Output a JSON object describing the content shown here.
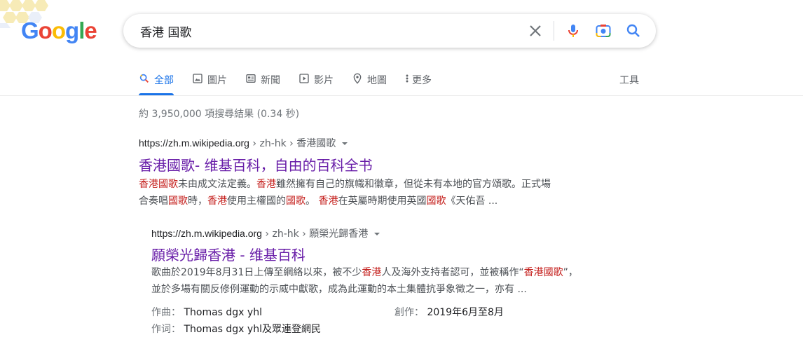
{
  "logo": {
    "letters": [
      {
        "ch": "G",
        "color": "#4285f4"
      },
      {
        "ch": "o",
        "color": "#ea4335"
      },
      {
        "ch": "o",
        "color": "#fbbc05"
      },
      {
        "ch": "g",
        "color": "#4285f4"
      },
      {
        "ch": "l",
        "color": "#34a853"
      },
      {
        "ch": "e",
        "color": "#ea4335"
      }
    ]
  },
  "search": {
    "query": "香港 国歌"
  },
  "tabs": [
    {
      "label": "全部",
      "icon": "search-icon",
      "active": true
    },
    {
      "label": "圖片",
      "icon": "image-icon",
      "active": false
    },
    {
      "label": "新聞",
      "icon": "news-icon",
      "active": false
    },
    {
      "label": "影片",
      "icon": "video-icon",
      "active": false
    },
    {
      "label": "地圖",
      "icon": "map-pin-icon",
      "active": false
    },
    {
      "label": "更多",
      "icon": "more-vert-icon",
      "active": false
    }
  ],
  "tools_label": "工具",
  "stats": "約 3,950,000 項搜尋結果 (0.34 秒)",
  "results": [
    {
      "domain": "https://zh.m.wikipedia.org",
      "path": " › zh-hk › 香港國歌",
      "title": "香港國歌- 维基百科，自由的百科全书",
      "snippet": [
        [
          [
            "香港國歌",
            true
          ],
          [
            "未由成文法定義。",
            false
          ],
          [
            "香港",
            true
          ],
          [
            "雖然擁有自己的旗幟和徽章，但從未有本地的官方頌歌。正式場",
            false
          ]
        ],
        [
          [
            "合奏唱",
            false
          ],
          [
            "國歌",
            true
          ],
          [
            "時，",
            false
          ],
          [
            "香港",
            true
          ],
          [
            "使用主權國的",
            false
          ],
          [
            "國歌",
            true
          ],
          [
            "。 ",
            false
          ],
          [
            "香港",
            true
          ],
          [
            "在英屬時期使用英國",
            false
          ],
          [
            "國歌",
            true
          ],
          [
            "《天佑吾 ...",
            false
          ]
        ]
      ]
    },
    {
      "domain": "https://zh.m.wikipedia.org",
      "path": " › zh-hk › 願榮光歸香港",
      "title": "願榮光歸香港 - 维基百科",
      "snippet": [
        [
          [
            "歌曲於2019年8月31日上傳至網絡以來，被不少",
            false
          ],
          [
            "香港",
            true
          ],
          [
            "人及海外支持者認可，並被稱作“",
            false
          ],
          [
            "香港國歌",
            true
          ],
          [
            "”，",
            false
          ]
        ],
        [
          [
            "並於多場有關反修例運動的示威中獻歌，成為此運動的本土集體抗爭象徵之一，亦有 ...",
            false
          ]
        ]
      ],
      "attributes": [
        {
          "key": "作曲：",
          "value": "Thomas dgx yhl"
        },
        {
          "key": "創作：",
          "value": "2019年6月至8月"
        },
        {
          "key": "作词：",
          "value": "Thomas dgx yhl及眾連登網民"
        }
      ]
    }
  ]
}
